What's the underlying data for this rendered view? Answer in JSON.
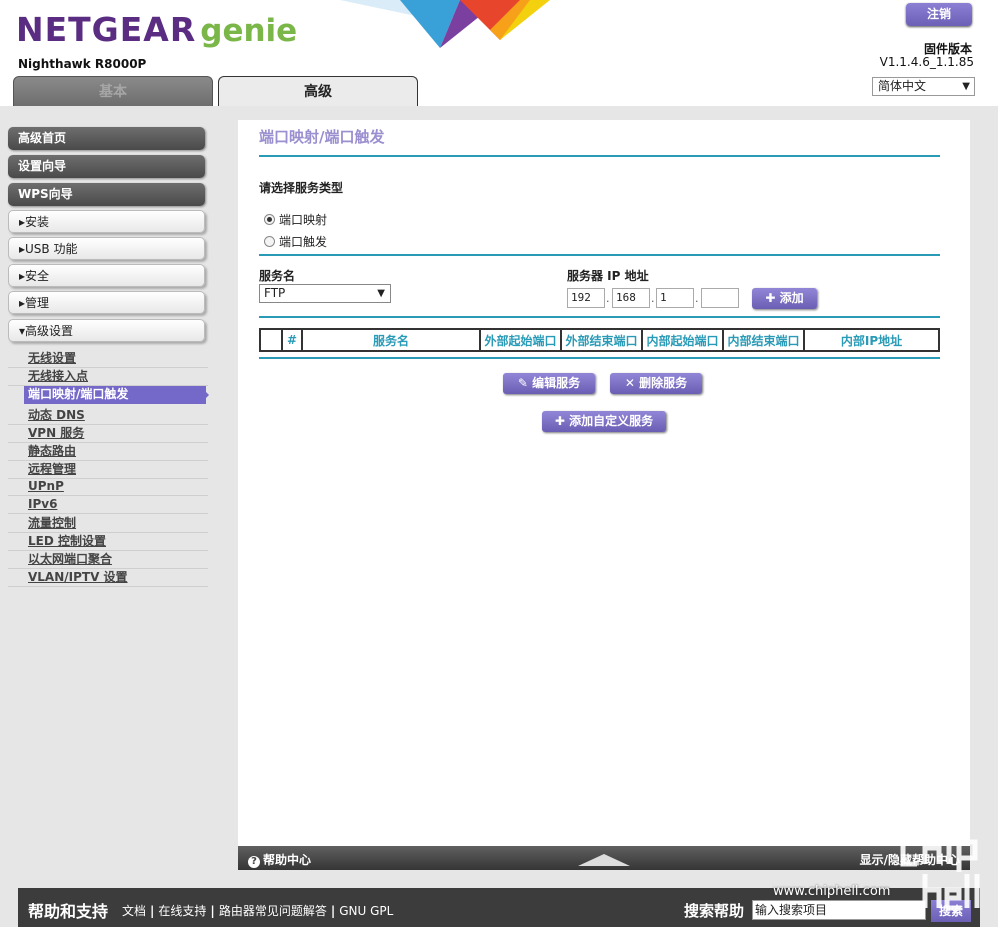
{
  "brand": {
    "name": "NETGEAR",
    "product": "genie",
    "model": "Nighthawk R8000P"
  },
  "header": {
    "logout_label": "注销",
    "firmware_label": "固件版本",
    "firmware_version": "V1.1.4.6_1.1.85",
    "language": "简体中文"
  },
  "tabs": {
    "basic": "基本",
    "advanced": "高级"
  },
  "sidebar": {
    "top_items": [
      "高级首页",
      "设置向导",
      "WPS向导"
    ],
    "sections": [
      "▸安装",
      "▸USB 功能",
      "▸安全",
      "▸管理",
      "▾高级设置"
    ],
    "sub_items": [
      "无线设置",
      "无线接入点",
      "端口映射/端口触发",
      "动态 DNS",
      "VPN 服务",
      "静态路由",
      "远程管理",
      "UPnP",
      "IPv6",
      "流量控制",
      "LED 控制设置",
      "以太网端口聚合",
      "VLAN/IPTV 设置"
    ],
    "active_sub": "端口映射/端口触发"
  },
  "main": {
    "title": "端口映射/端口触发",
    "service_type_label": "请选择服务类型",
    "radio_forwarding": "端口映射",
    "radio_triggering": "端口触发",
    "service_name_label": "服务名",
    "service_name_value": "FTP",
    "server_ip_label": "服务器 IP 地址",
    "ip_octets": [
      "192",
      "168",
      "1",
      ""
    ],
    "add_button": "添加",
    "table_headers": [
      "",
      "#",
      "服务名",
      "外部起始端口",
      "外部结束端口",
      "内部起始端口",
      "内部结束端口",
      "内部IP地址"
    ],
    "edit_button": "编辑服务",
    "delete_button": "删除服务",
    "add_custom_button": "添加自定义服务"
  },
  "panel_footer": {
    "help_center": "帮助中心",
    "show_hide": "显示/隐藏帮助中心"
  },
  "footer": {
    "title": "帮助和支持",
    "links": [
      "文档",
      "在线支持",
      "路由器常见问题解答",
      "GNU GPL"
    ],
    "search_label": "搜索帮助",
    "search_placeholder": "输入搜索项目",
    "search_button": "搜索"
  },
  "watermark": {
    "text": "www.chiphell.com",
    "logo": "chip hell"
  }
}
